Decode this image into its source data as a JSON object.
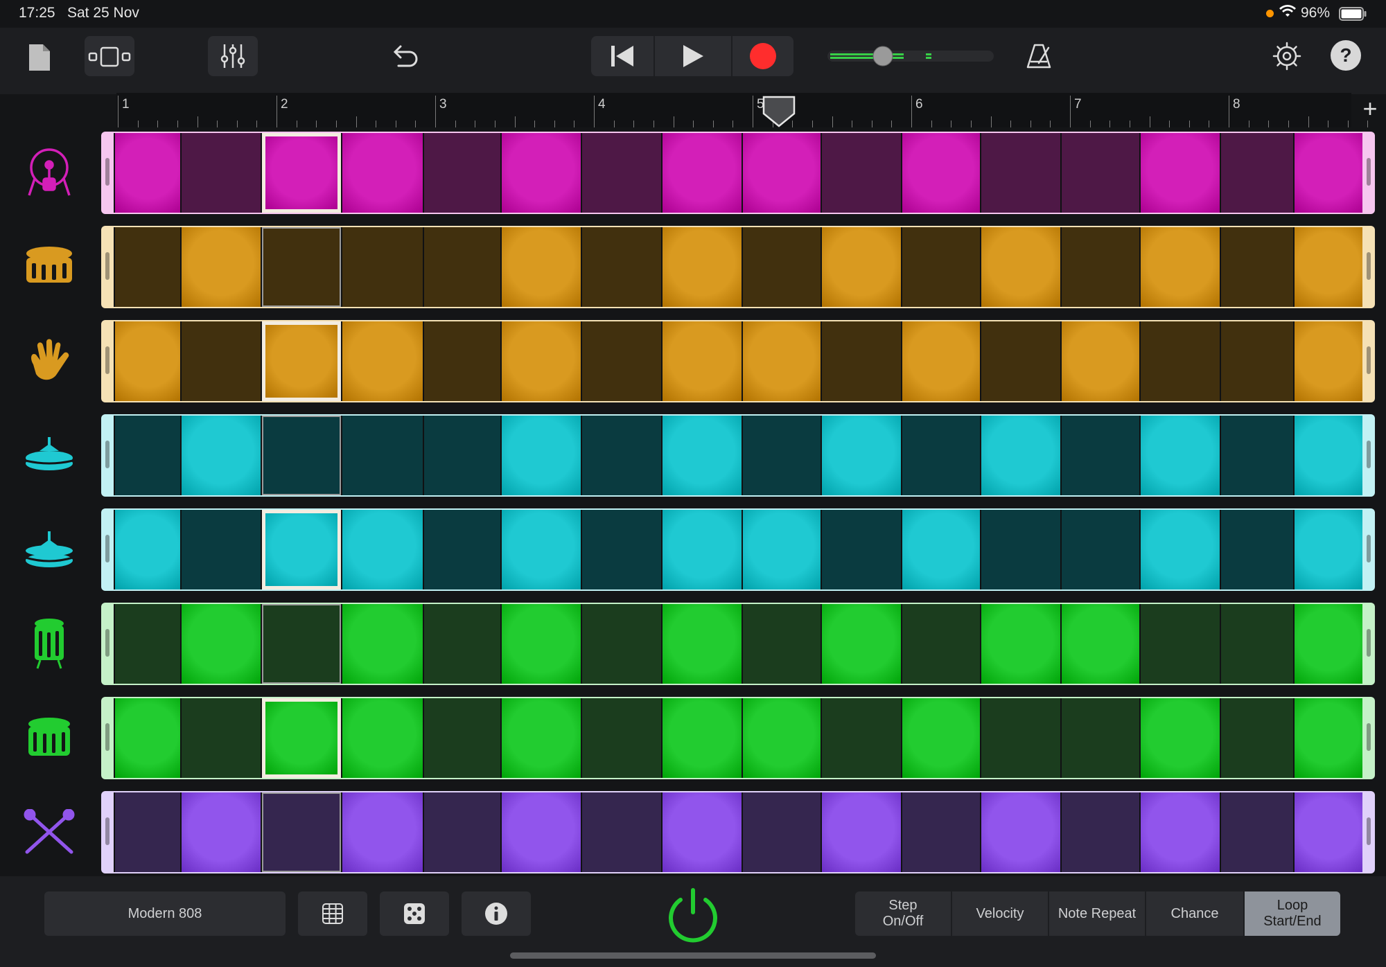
{
  "status": {
    "time": "17:25",
    "date": "Sat 25 Nov",
    "battery": "96%"
  },
  "toolbar": {
    "icons": [
      "document-icon",
      "view-toggle-icon",
      "mixer-icon",
      "undo-icon",
      "rewind-icon",
      "play-icon",
      "record-icon",
      "volume-slider",
      "metronome-icon",
      "settings-gear-icon",
      "help-icon"
    ],
    "help_label": "?"
  },
  "ruler": {
    "bars": [
      "1",
      "2",
      "3",
      "4",
      "5",
      "6",
      "7",
      "8"
    ],
    "add_label": "+"
  },
  "tracks": [
    {
      "instrument": "kick-drum",
      "color": "#d31fb8",
      "dim": "#4e1846",
      "border": "#f6c6ef",
      "steps": [
        1,
        0,
        1,
        1,
        0,
        1,
        0,
        1,
        1,
        0,
        1,
        0,
        0,
        1,
        0,
        1
      ]
    },
    {
      "instrument": "snare-drum",
      "color": "#d99a20",
      "dim": "#41300e",
      "border": "#f5e1b5",
      "steps": [
        0,
        1,
        0,
        0,
        0,
        1,
        0,
        1,
        0,
        1,
        0,
        1,
        0,
        1,
        0,
        1
      ]
    },
    {
      "instrument": "clap",
      "color": "#d99a20",
      "dim": "#41300e",
      "border": "#f5e1b5",
      "steps": [
        1,
        0,
        1,
        1,
        0,
        1,
        0,
        1,
        1,
        0,
        1,
        0,
        1,
        0,
        0,
        1
      ]
    },
    {
      "instrument": "closed-hihat",
      "color": "#1fc9d2",
      "dim": "#0a3b40",
      "border": "#c2f1f4",
      "steps": [
        0,
        1,
        0,
        0,
        0,
        1,
        0,
        1,
        0,
        1,
        0,
        1,
        0,
        1,
        0,
        1
      ]
    },
    {
      "instrument": "open-hihat",
      "color": "#1fc9d2",
      "dim": "#0a3b40",
      "border": "#c2f1f4",
      "steps": [
        1,
        0,
        1,
        1,
        0,
        1,
        0,
        1,
        1,
        0,
        1,
        0,
        0,
        1,
        0,
        1
      ]
    },
    {
      "instrument": "tom-high",
      "color": "#22cc30",
      "dim": "#1b3d1e",
      "border": "#c5f1c8",
      "steps": [
        0,
        1,
        0,
        1,
        0,
        1,
        0,
        1,
        0,
        1,
        0,
        1,
        1,
        0,
        0,
        1
      ]
    },
    {
      "instrument": "tom-low",
      "color": "#22cc30",
      "dim": "#1b3d1e",
      "border": "#c5f1c8",
      "steps": [
        1,
        0,
        1,
        1,
        0,
        1,
        0,
        1,
        1,
        0,
        1,
        0,
        0,
        1,
        0,
        1
      ]
    },
    {
      "instrument": "sticks",
      "color": "#9155ec",
      "dim": "#35264f",
      "border": "#e0d1fa",
      "steps": [
        0,
        1,
        0,
        1,
        0,
        1,
        0,
        1,
        0,
        1,
        0,
        1,
        0,
        1,
        0,
        1
      ]
    }
  ],
  "selected_step": 3,
  "bottom": {
    "kit_name": "Modern 808",
    "icons": [
      "grid-icon",
      "dice-icon",
      "info-icon",
      "power-icon"
    ],
    "modes": [
      "Step On/Off",
      "Velocity",
      "Note Repeat",
      "Chance",
      "Loop Start/End"
    ],
    "active_mode": "Loop Start/End"
  },
  "accent": {
    "record": "#ff2d2d",
    "power": "#22cc30",
    "volume": "#38d048"
  }
}
